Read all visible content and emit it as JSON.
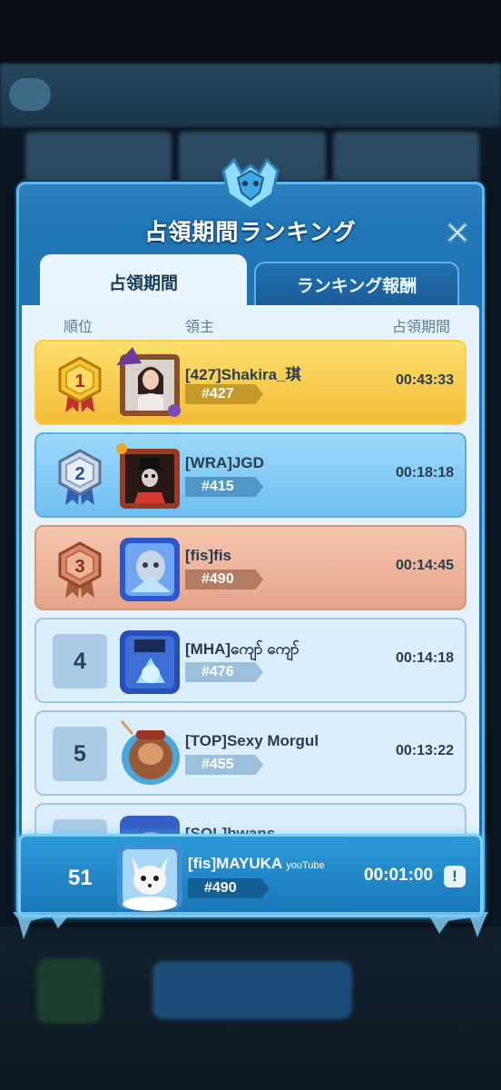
{
  "panel": {
    "title": "占領期間ランキング"
  },
  "tabs": [
    {
      "label": "占領期間",
      "active": true
    },
    {
      "label": "ランキング報酬",
      "active": false
    }
  ],
  "columns": {
    "rank": "順位",
    "lord": "領主",
    "period": "占領期間"
  },
  "rows": [
    {
      "rank": "1",
      "name": "[427]Shakira_琪",
      "server": "#427",
      "time": "00:43:33",
      "style": "gold"
    },
    {
      "rank": "2",
      "name": "[WRA]JGD",
      "server": "#415",
      "time": "00:18:18",
      "style": "silver"
    },
    {
      "rank": "3",
      "name": "[fis]fis",
      "server": "#490",
      "time": "00:14:45",
      "style": "bronze"
    },
    {
      "rank": "4",
      "name": "[MHA]ကျော် ကျော်",
      "server": "#476",
      "time": "00:14:18",
      "style": "plain"
    },
    {
      "rank": "5",
      "name": "[TOP]Sexy Morgul",
      "server": "#455",
      "time": "00:13:22",
      "style": "plain"
    },
    {
      "rank": "",
      "name": "[SOL]bwans",
      "server": "",
      "time": "",
      "style": "plain"
    }
  ],
  "self": {
    "rank": "51",
    "name": "[fis]MAYUKA",
    "name_suffix": "youTube",
    "server": "#490",
    "time": "00:01:00",
    "info": "!"
  },
  "colors": {
    "gold": "#f1bc36",
    "silver": "#6fc0f0",
    "bronze": "#e5a58a",
    "plain": "#dbeefb",
    "panel": "#1a6aa4",
    "self_row": "#1977b8"
  },
  "icons": {
    "close": "close-icon",
    "crest": "crest-icon",
    "rank1": "gold-medal-icon",
    "rank2": "silver-medal-icon",
    "rank3": "bronze-medal-icon"
  }
}
